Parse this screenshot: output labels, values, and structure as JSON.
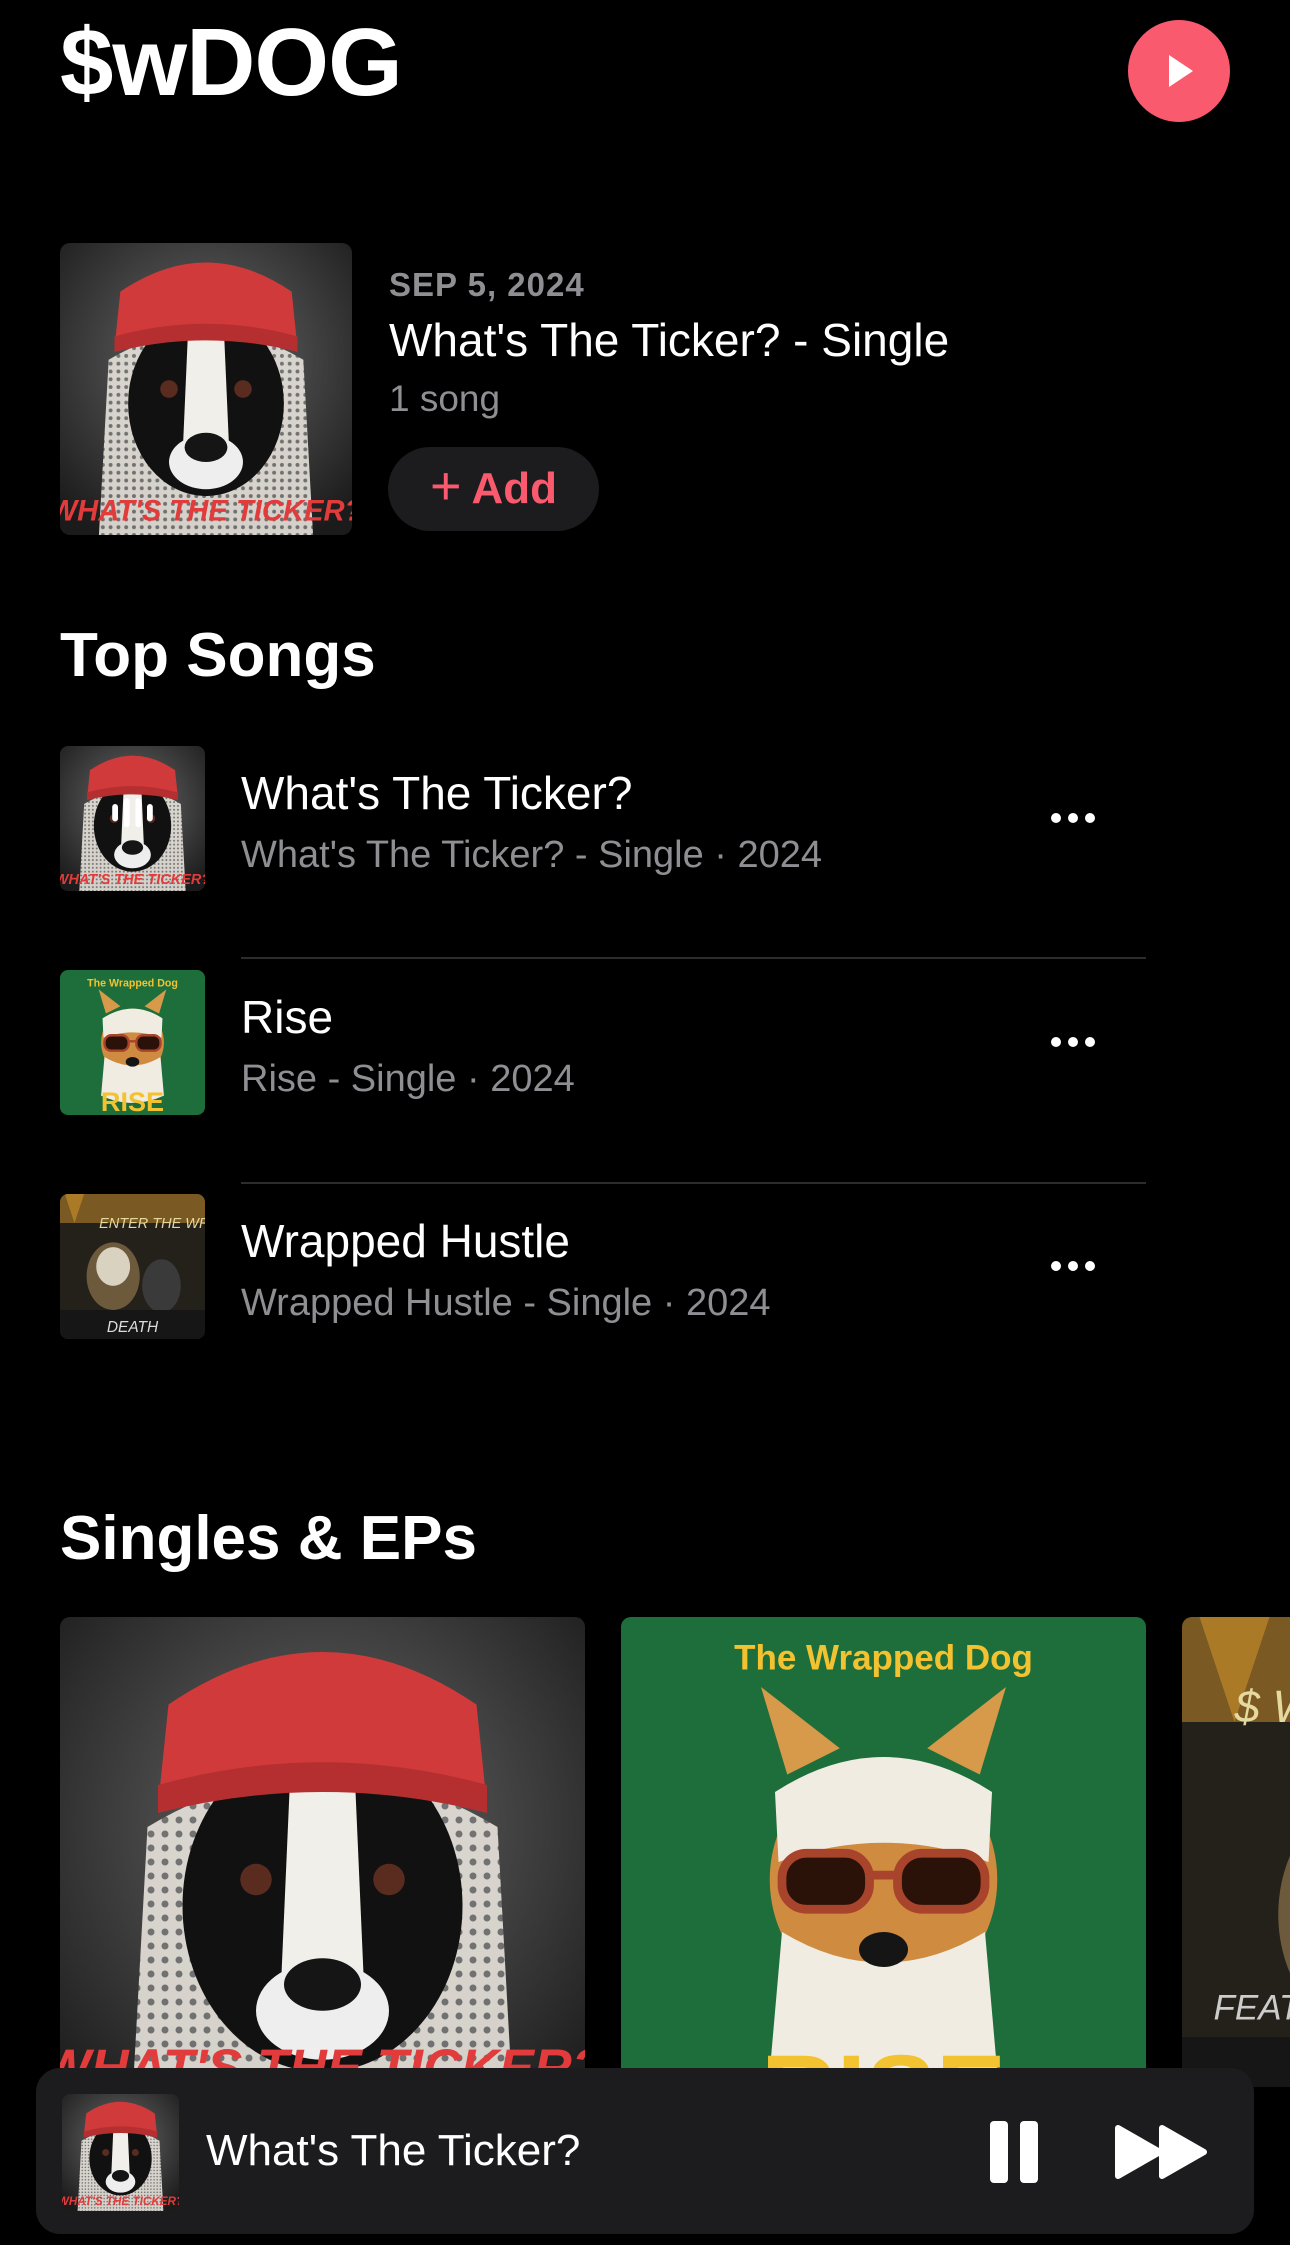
{
  "artist": {
    "name": "$wDOG"
  },
  "latest_release": {
    "date": "SEP 5, 2024",
    "title": "What's The Ticker? - Single",
    "count": "1 song",
    "add_label": "Add",
    "art_text": "WHAT'S THE TICKER?"
  },
  "top_songs": {
    "heading": "Top Songs",
    "items": [
      {
        "title": "What's The Ticker?",
        "subtitle": "What's The Ticker? - Single · 2024",
        "art_text": "WHAT'S THE TICKER?"
      },
      {
        "title": "Rise",
        "subtitle": "Rise - Single · 2024",
        "art_top": "The Wrapped Dog",
        "art_text": "RISE"
      },
      {
        "title": "Wrapped Hustle",
        "subtitle": "Wrapped Hustle - Single · 2024",
        "art_top": "ENTER THE WRAP",
        "art_text": "DEATH"
      }
    ]
  },
  "singles": {
    "heading": "Singles & EPs",
    "cards": [
      {
        "art_text": "WHAT'S THE TICKER?"
      },
      {
        "art_top": "The Wrapped Dog",
        "art_text": "RISE"
      },
      {
        "art_top": "$ WDOG",
        "art_text": "FEAT"
      }
    ]
  },
  "now_playing": {
    "title": "What's The Ticker?"
  },
  "colors": {
    "accent": "#fa5a6e",
    "background": "#000000",
    "secondary_text": "#8e8e93",
    "surface": "#1c1c1e"
  },
  "icons": [
    "play-icon",
    "plus-icon",
    "more-icon",
    "pause-icon",
    "fast-forward-icon",
    "now-playing-bars-icon"
  ]
}
